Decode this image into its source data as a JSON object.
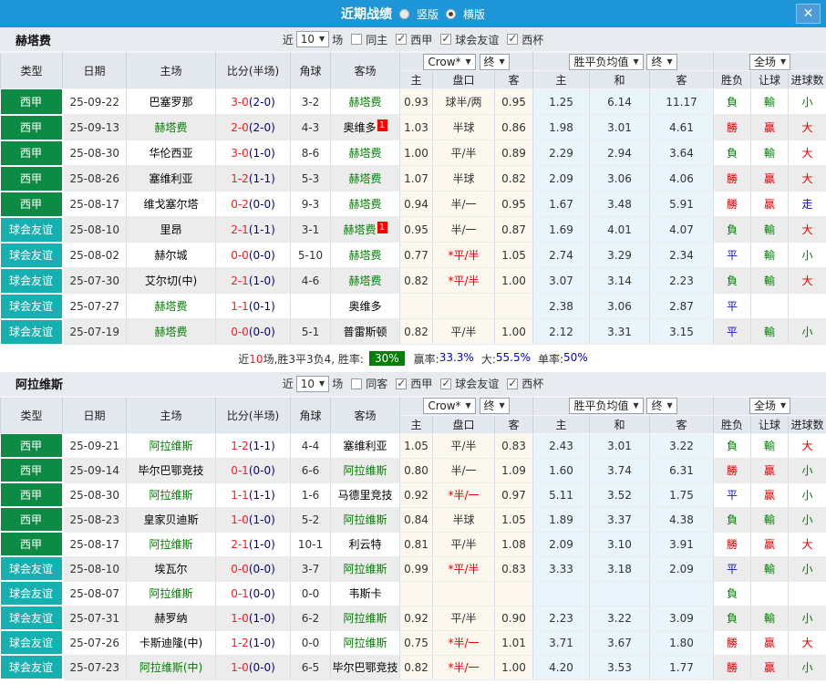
{
  "titlebar": {
    "title": "近期战绩",
    "close": "✕",
    "options": [
      {
        "label": "竖版",
        "selected": false
      },
      {
        "label": "横版",
        "selected": true
      }
    ]
  },
  "labels": {
    "near": "近",
    "matches": "场"
  },
  "colors": {
    "titlebar_bg": "#1e95d6",
    "league_bg": "#0d8a44",
    "friendly_bg": "#17b0b0",
    "focus_team": "#008000",
    "score_ft": "#ff1a1a",
    "score_ht": "#000090",
    "odds_col_bg": "#fdf8ee",
    "avg_col_bg": "#eaf5fb",
    "result": {
      "勝": "#e60000",
      "贏": "#e60000",
      "大": "#e60000",
      "負": "#008000",
      "輸": "#008000",
      "小": "#008000",
      "平": "#1010d0",
      "走": "#1010d0"
    }
  },
  "columns": {
    "main": [
      "类型",
      "日期",
      "主场",
      "比分(半场)",
      "角球",
      "客场"
    ],
    "sub": [
      "主",
      "盘口",
      "客",
      "主",
      "和",
      "客",
      "胜负",
      "让球",
      "进球数"
    ],
    "odds_company": "Crow*",
    "odds_final": "终",
    "avg_select": "胜平负均值",
    "avg_final": "终",
    "scope_select": "全场"
  },
  "sections": [
    {
      "team": "赫塔费",
      "filter": {
        "count": "10",
        "same": {
          "label": "同主",
          "checked": false
        },
        "comps": [
          {
            "label": "西甲",
            "checked": true
          },
          {
            "label": "球会友谊",
            "checked": true
          },
          {
            "label": "西杯",
            "checked": true
          }
        ]
      },
      "rows": [
        {
          "type": "西甲",
          "date": "25-09-22",
          "home": "巴塞罗那",
          "home_focus": false,
          "ft": "3-0",
          "ht": "(2-0)",
          "corner": "3-2",
          "away": "赫塔费",
          "away_focus": true,
          "odds": [
            "0.93",
            "球半/两",
            "0.95"
          ],
          "avg": [
            "1.25",
            "6.14",
            "11.17"
          ],
          "res": [
            "負",
            "輸",
            "小"
          ]
        },
        {
          "type": "西甲",
          "date": "25-09-13",
          "home": "赫塔费",
          "home_focus": true,
          "ft": "2-0",
          "ht": "(2-0)",
          "corner": "4-3",
          "away": "奥维多",
          "away_focus": false,
          "away_badge": "1",
          "odds": [
            "1.03",
            "半球",
            "0.86"
          ],
          "avg": [
            "1.98",
            "3.01",
            "4.61"
          ],
          "res": [
            "勝",
            "贏",
            "大"
          ]
        },
        {
          "type": "西甲",
          "date": "25-08-30",
          "home": "华伦西亚",
          "home_focus": false,
          "ft": "3-0",
          "ht": "(1-0)",
          "corner": "8-6",
          "away": "赫塔费",
          "away_focus": true,
          "odds": [
            "1.00",
            "平/半",
            "0.89"
          ],
          "avg": [
            "2.29",
            "2.94",
            "3.64"
          ],
          "res": [
            "負",
            "輸",
            "大"
          ]
        },
        {
          "type": "西甲",
          "date": "25-08-26",
          "home": "塞维利亚",
          "home_focus": false,
          "ft": "1-2",
          "ht": "(1-1)",
          "corner": "5-3",
          "away": "赫塔费",
          "away_focus": true,
          "odds": [
            "1.07",
            "半球",
            "0.82"
          ],
          "avg": [
            "2.09",
            "3.06",
            "4.06"
          ],
          "res": [
            "勝",
            "贏",
            "大"
          ]
        },
        {
          "type": "西甲",
          "date": "25-08-17",
          "home": "维戈塞尔塔",
          "home_focus": false,
          "ft": "0-2",
          "ht": "(0-0)",
          "corner": "9-3",
          "away": "赫塔费",
          "away_focus": true,
          "odds": [
            "0.94",
            "半/一",
            "0.95"
          ],
          "avg": [
            "1.67",
            "3.48",
            "5.91"
          ],
          "res": [
            "勝",
            "贏",
            "走"
          ]
        },
        {
          "type": "球会友谊",
          "date": "25-08-10",
          "home": "里昂",
          "home_focus": false,
          "ft": "2-1",
          "ht": "(1-1)",
          "corner": "3-1",
          "away": "赫塔费",
          "away_focus": true,
          "away_badge": "1",
          "odds": [
            "0.95",
            "半/一",
            "0.87"
          ],
          "avg": [
            "1.69",
            "4.01",
            "4.07"
          ],
          "res": [
            "負",
            "輸",
            "大"
          ]
        },
        {
          "type": "球会友谊",
          "date": "25-08-02",
          "home": "赫尔城",
          "home_focus": false,
          "ft": "0-0",
          "ht": "(0-0)",
          "corner": "5-10",
          "away": "赫塔费",
          "away_focus": true,
          "odds": [
            "0.77",
            "*平/半",
            "1.05"
          ],
          "avg": [
            "2.74",
            "3.29",
            "2.34"
          ],
          "res": [
            "平",
            "輸",
            "小"
          ]
        },
        {
          "type": "球会友谊",
          "date": "25-07-30",
          "home": "艾尔切(中)",
          "home_focus": false,
          "ft": "2-1",
          "ht": "(1-0)",
          "corner": "4-6",
          "away": "赫塔费",
          "away_focus": true,
          "odds": [
            "0.82",
            "*平/半",
            "1.00"
          ],
          "avg": [
            "3.07",
            "3.14",
            "2.23"
          ],
          "res": [
            "負",
            "輸",
            "大"
          ]
        },
        {
          "type": "球会友谊",
          "date": "25-07-27",
          "home": "赫塔费",
          "home_focus": true,
          "ft": "1-1",
          "ht": "(0-1)",
          "corner": "",
          "away": "奥维多",
          "away_focus": false,
          "odds": [
            "",
            "",
            ""
          ],
          "avg": [
            "2.38",
            "3.06",
            "2.87"
          ],
          "res": [
            "平",
            "",
            ""
          ]
        },
        {
          "type": "球会友谊",
          "date": "25-07-19",
          "home": "赫塔费",
          "home_focus": true,
          "ft": "0-0",
          "ht": "(0-0)",
          "corner": "5-1",
          "away": "普雷斯顿",
          "away_focus": false,
          "odds": [
            "0.82",
            "平/半",
            "1.00"
          ],
          "avg": [
            "2.12",
            "3.31",
            "3.15"
          ],
          "res": [
            "平",
            "輸",
            "小"
          ]
        }
      ],
      "summary": {
        "pre": "近",
        "num": "10",
        "mid": "场,胜3平3负4, 胜率:",
        "rate": "30%",
        "stats": [
          {
            "label": "赢率:",
            "value": "33.3%"
          },
          {
            "label": "大:",
            "value": "55.5%"
          },
          {
            "label": "单率:",
            "value": "50%"
          }
        ]
      }
    },
    {
      "team": "阿拉维斯",
      "filter": {
        "count": "10",
        "same": {
          "label": "同客",
          "checked": false
        },
        "comps": [
          {
            "label": "西甲",
            "checked": true
          },
          {
            "label": "球会友谊",
            "checked": true
          },
          {
            "label": "西杯",
            "checked": true
          }
        ]
      },
      "rows": [
        {
          "type": "西甲",
          "date": "25-09-21",
          "home": "阿拉维斯",
          "home_focus": true,
          "ft": "1-2",
          "ht": "(1-1)",
          "corner": "4-4",
          "away": "塞维利亚",
          "away_focus": false,
          "odds": [
            "1.05",
            "平/半",
            "0.83"
          ],
          "avg": [
            "2.43",
            "3.01",
            "3.22"
          ],
          "res": [
            "負",
            "輸",
            "大"
          ]
        },
        {
          "type": "西甲",
          "date": "25-09-14",
          "home": "毕尔巴鄂竞技",
          "home_focus": false,
          "ft": "0-1",
          "ht": "(0-0)",
          "corner": "6-6",
          "away": "阿拉维斯",
          "away_focus": true,
          "odds": [
            "0.80",
            "半/一",
            "1.09"
          ],
          "avg": [
            "1.60",
            "3.74",
            "6.31"
          ],
          "res": [
            "勝",
            "贏",
            "小"
          ]
        },
        {
          "type": "西甲",
          "date": "25-08-30",
          "home": "阿拉维斯",
          "home_focus": true,
          "ft": "1-1",
          "ht": "(1-1)",
          "corner": "1-6",
          "away": "马德里竞技",
          "away_focus": false,
          "odds": [
            "0.92",
            "*半/一",
            "0.97"
          ],
          "avg": [
            "5.11",
            "3.52",
            "1.75"
          ],
          "res": [
            "平",
            "贏",
            "小"
          ]
        },
        {
          "type": "西甲",
          "date": "25-08-23",
          "home": "皇家贝迪斯",
          "home_focus": false,
          "ft": "1-0",
          "ht": "(1-0)",
          "corner": "5-2",
          "away": "阿拉维斯",
          "away_focus": true,
          "odds": [
            "0.84",
            "半球",
            "1.05"
          ],
          "avg": [
            "1.89",
            "3.37",
            "4.38"
          ],
          "res": [
            "負",
            "輸",
            "小"
          ]
        },
        {
          "type": "西甲",
          "date": "25-08-17",
          "home": "阿拉维斯",
          "home_focus": true,
          "ft": "2-1",
          "ht": "(1-0)",
          "corner": "10-1",
          "away": "利云特",
          "away_focus": false,
          "odds": [
            "0.81",
            "平/半",
            "1.08"
          ],
          "avg": [
            "2.09",
            "3.10",
            "3.91"
          ],
          "res": [
            "勝",
            "贏",
            "大"
          ]
        },
        {
          "type": "球会友谊",
          "date": "25-08-10",
          "home": "埃瓦尔",
          "home_focus": false,
          "ft": "0-0",
          "ht": "(0-0)",
          "corner": "3-7",
          "away": "阿拉维斯",
          "away_focus": true,
          "odds": [
            "0.99",
            "*平/半",
            "0.83"
          ],
          "avg": [
            "3.33",
            "3.18",
            "2.09"
          ],
          "res": [
            "平",
            "輸",
            "小"
          ]
        },
        {
          "type": "球会友谊",
          "date": "25-08-07",
          "home": "阿拉维斯",
          "home_focus": true,
          "ft": "0-1",
          "ht": "(0-0)",
          "corner": "0-0",
          "away": "韦斯卡",
          "away_focus": false,
          "odds": [
            "",
            "",
            ""
          ],
          "avg": [
            "",
            "",
            ""
          ],
          "res": [
            "負",
            "",
            ""
          ]
        },
        {
          "type": "球会友谊",
          "date": "25-07-31",
          "home": "赫罗纳",
          "home_focus": false,
          "ft": "1-0",
          "ht": "(1-0)",
          "corner": "6-2",
          "away": "阿拉维斯",
          "away_focus": true,
          "odds": [
            "0.92",
            "平/半",
            "0.90"
          ],
          "avg": [
            "2.23",
            "3.22",
            "3.09"
          ],
          "res": [
            "負",
            "輸",
            "小"
          ]
        },
        {
          "type": "球会友谊",
          "date": "25-07-26",
          "home": "卡斯迪隆(中)",
          "home_focus": false,
          "ft": "1-2",
          "ht": "(1-0)",
          "corner": "0-0",
          "away": "阿拉维斯",
          "away_focus": true,
          "odds": [
            "0.75",
            "*半/一",
            "1.01"
          ],
          "avg": [
            "3.71",
            "3.67",
            "1.80"
          ],
          "res": [
            "勝",
            "贏",
            "大"
          ]
        },
        {
          "type": "球会友谊",
          "date": "25-07-23",
          "home": "阿拉维斯(中)",
          "home_focus": true,
          "ft": "1-0",
          "ht": "(0-0)",
          "corner": "6-5",
          "away": "毕尔巴鄂竞技",
          "away_focus": false,
          "odds": [
            "0.82",
            "*半/一",
            "1.00"
          ],
          "avg": [
            "4.20",
            "3.53",
            "1.77"
          ],
          "res": [
            "勝",
            "贏",
            "小"
          ]
        }
      ]
    }
  ]
}
